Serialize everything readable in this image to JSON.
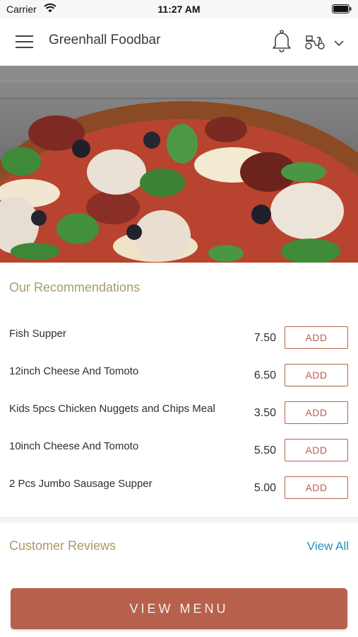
{
  "status_bar": {
    "carrier": "Carrier",
    "time": "11:27 AM"
  },
  "header": {
    "title": "Greenhall Foodbar",
    "icons": [
      "menu-icon",
      "bell-icon",
      "scooter-icon",
      "chevron-down-icon"
    ]
  },
  "hero": {
    "icon": "pizza-image"
  },
  "recommendations": {
    "title": "Our Recommendations",
    "add_label": "ADD",
    "items": [
      {
        "name": "Fish Supper",
        "price": "7.50"
      },
      {
        "name": "12inch Cheese And Tomoto",
        "price": "6.50"
      },
      {
        "name": "Kids 5pcs Chicken Nuggets and Chips Meal",
        "price": "3.50"
      },
      {
        "name": "10inch Cheese And Tomoto",
        "price": "5.50"
      },
      {
        "name": "2 Pcs Jumbo Sausage Supper",
        "price": "5.00"
      }
    ]
  },
  "reviews": {
    "title": "Customer Reviews",
    "view_all": "View All"
  },
  "cta": {
    "label": "VIEW MENU"
  },
  "colors": {
    "accent": "#b7614d",
    "section_title": "#a89a6a",
    "link": "#2a8fb8"
  }
}
